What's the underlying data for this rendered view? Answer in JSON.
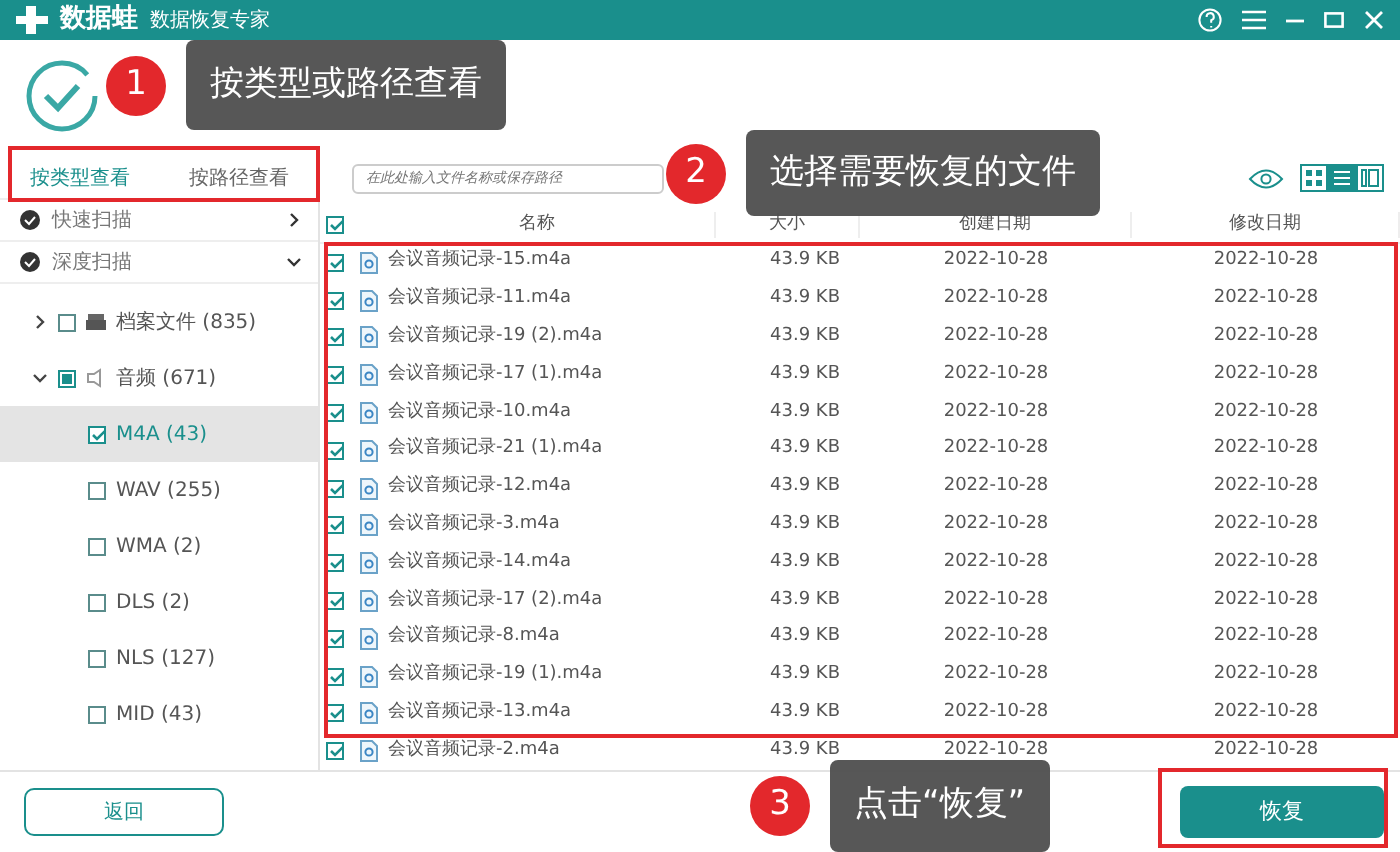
{
  "window": {
    "app_name": "数据蛙",
    "subtitle": "数据恢复专家"
  },
  "view_tabs": [
    {
      "label": "按类型查看",
      "selected": true
    },
    {
      "label": "按路径查看",
      "selected": false
    }
  ],
  "scans": [
    {
      "label": "快速扫描",
      "expanded": false
    },
    {
      "label": "深度扫描",
      "expanded": true
    }
  ],
  "tree": [
    {
      "label": "档案文件 (835)",
      "expanded": false,
      "checked": false,
      "partial": false,
      "selected": false,
      "kind": "archive"
    },
    {
      "label": "音频 (671)",
      "expanded": true,
      "partial": true,
      "selected": false,
      "kind": "audio",
      "children": [
        {
          "label": "M4A (43)",
          "checked": true,
          "selected": true
        },
        {
          "label": "WAV (255)",
          "checked": false,
          "selected": false
        },
        {
          "label": "WMA (2)",
          "checked": false,
          "selected": false
        },
        {
          "label": "DLS (2)",
          "checked": false,
          "selected": false
        },
        {
          "label": "NLS (127)",
          "checked": false,
          "selected": false
        },
        {
          "label": "MID (43)",
          "checked": false,
          "selected": false
        }
      ]
    }
  ],
  "search": {
    "placeholder": "在此处输入文件名称或保存路径"
  },
  "view_modes": [
    {
      "selected": false,
      "kind": "grid"
    },
    {
      "selected": true,
      "kind": "list"
    },
    {
      "selected": false,
      "kind": "columns"
    }
  ],
  "table": {
    "all_checked": true,
    "columns": [
      "名称",
      "大小",
      "创建日期",
      "修改日期"
    ],
    "rows": [
      {
        "checked": true,
        "name": "会议音频记录-15.m4a",
        "size": "43.9 KB",
        "created": "2022-10-28",
        "modified": "2022-10-28"
      },
      {
        "checked": true,
        "name": "会议音频记录-11.m4a",
        "size": "43.9 KB",
        "created": "2022-10-28",
        "modified": "2022-10-28"
      },
      {
        "checked": true,
        "name": "会议音频记录-19 (2).m4a",
        "size": "43.9 KB",
        "created": "2022-10-28",
        "modified": "2022-10-28"
      },
      {
        "checked": true,
        "name": "会议音频记录-17 (1).m4a",
        "size": "43.9 KB",
        "created": "2022-10-28",
        "modified": "2022-10-28"
      },
      {
        "checked": true,
        "name": "会议音频记录-10.m4a",
        "size": "43.9 KB",
        "created": "2022-10-28",
        "modified": "2022-10-28"
      },
      {
        "checked": true,
        "name": "会议音频记录-21 (1).m4a",
        "size": "43.9 KB",
        "created": "2022-10-28",
        "modified": "2022-10-28"
      },
      {
        "checked": true,
        "name": "会议音频记录-12.m4a",
        "size": "43.9 KB",
        "created": "2022-10-28",
        "modified": "2022-10-28"
      },
      {
        "checked": true,
        "name": "会议音频记录-3.m4a",
        "size": "43.9 KB",
        "created": "2022-10-28",
        "modified": "2022-10-28"
      },
      {
        "checked": true,
        "name": "会议音频记录-14.m4a",
        "size": "43.9 KB",
        "created": "2022-10-28",
        "modified": "2022-10-28"
      },
      {
        "checked": true,
        "name": "会议音频记录-17 (2).m4a",
        "size": "43.9 KB",
        "created": "2022-10-28",
        "modified": "2022-10-28"
      },
      {
        "checked": true,
        "name": "会议音频记录-8.m4a",
        "size": "43.9 KB",
        "created": "2022-10-28",
        "modified": "2022-10-28"
      },
      {
        "checked": true,
        "name": "会议音频记录-19 (1).m4a",
        "size": "43.9 KB",
        "created": "2022-10-28",
        "modified": "2022-10-28"
      },
      {
        "checked": true,
        "name": "会议音频记录-13.m4a",
        "size": "43.9 KB",
        "created": "2022-10-28",
        "modified": "2022-10-28"
      },
      {
        "checked": true,
        "name": "会议音频记录-2.m4a",
        "size": "43.9 KB",
        "created": "2022-10-28",
        "modified": "2022-10-28"
      }
    ]
  },
  "buttons": {
    "back": "返回",
    "recover": "恢复"
  },
  "callouts": [
    {
      "number": "1",
      "text": "按类型或路径查看"
    },
    {
      "number": "2",
      "text": "选择需要恢复的文件"
    },
    {
      "number": "3",
      "text": "点击“恢复”"
    }
  ]
}
